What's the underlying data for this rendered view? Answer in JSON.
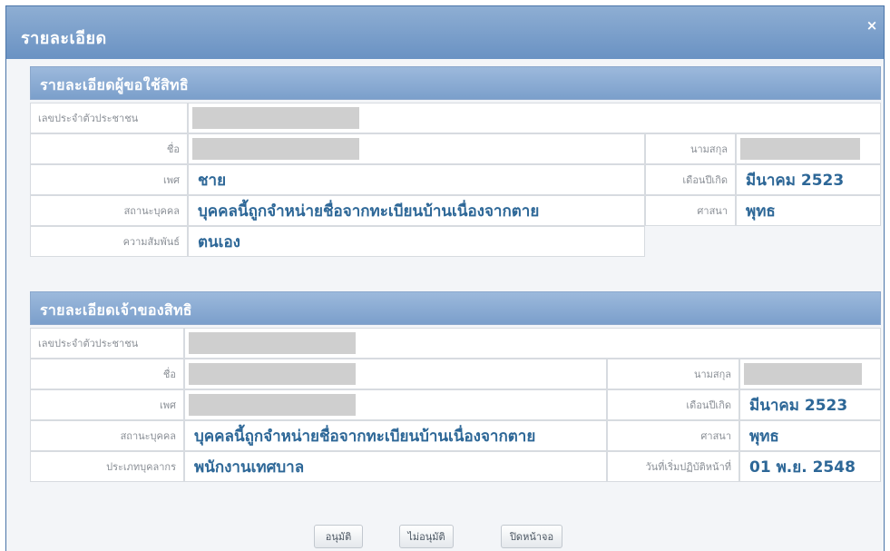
{
  "dialog": {
    "title": "รายละเอียด",
    "close_label": "×"
  },
  "requester": {
    "title": "รายละเอียดผู้ขอใช้สิทธิ",
    "citizen_id_label": "เลขประจำตัวประชาชน",
    "first_name_label": "ชื่อ",
    "last_name_label": "นามสกุล",
    "gender_label": "เพศ",
    "gender_value": "ชาย",
    "birth_label": "เดือนปีเกิด",
    "birth_value": "มีนาคม 2523",
    "status_label": "สถานะบุคคล",
    "status_value": "บุคคลนี้ถูกจำหน่ายชื่อจากทะเบียนบ้านเนื่องจากตาย",
    "religion_label": "ศาสนา",
    "religion_value": "พุทธ",
    "relation_label": "ความสัมพันธ์",
    "relation_value": "ตนเอง"
  },
  "owner": {
    "title": "รายละเอียดเจ้าของสิทธิ",
    "citizen_id_label": "เลขประจำตัวประชาชน",
    "first_name_label": "ชื่อ",
    "last_name_label": "นามสกุล",
    "gender_label": "เพศ",
    "birth_label": "เดือนปีเกิด",
    "birth_value": "มีนาคม 2523",
    "status_label": "สถานะบุคคล",
    "status_value": "บุคคลนี้ถูกจำหน่ายชื่อจากทะเบียนบ้านเนื่องจากตาย",
    "religion_label": "ศาสนา",
    "religion_value": "พุทธ",
    "personnel_type_label": "ประเภทบุคลากร",
    "personnel_type_value": "พนักงานเทศบาล",
    "start_date_label": "วันที่เริ่มปฏิบัติหน้าที่",
    "start_date_value": "01 พ.ย. 2548"
  },
  "buttons": {
    "approve": "อนุมัติ",
    "reject": "ไม่อนุมัติ",
    "close": "ปิดหน้าจอ"
  },
  "colors": {
    "header": "#7b9fcb",
    "value_text": "#2d6797",
    "redaction": "#cfcfcf"
  }
}
